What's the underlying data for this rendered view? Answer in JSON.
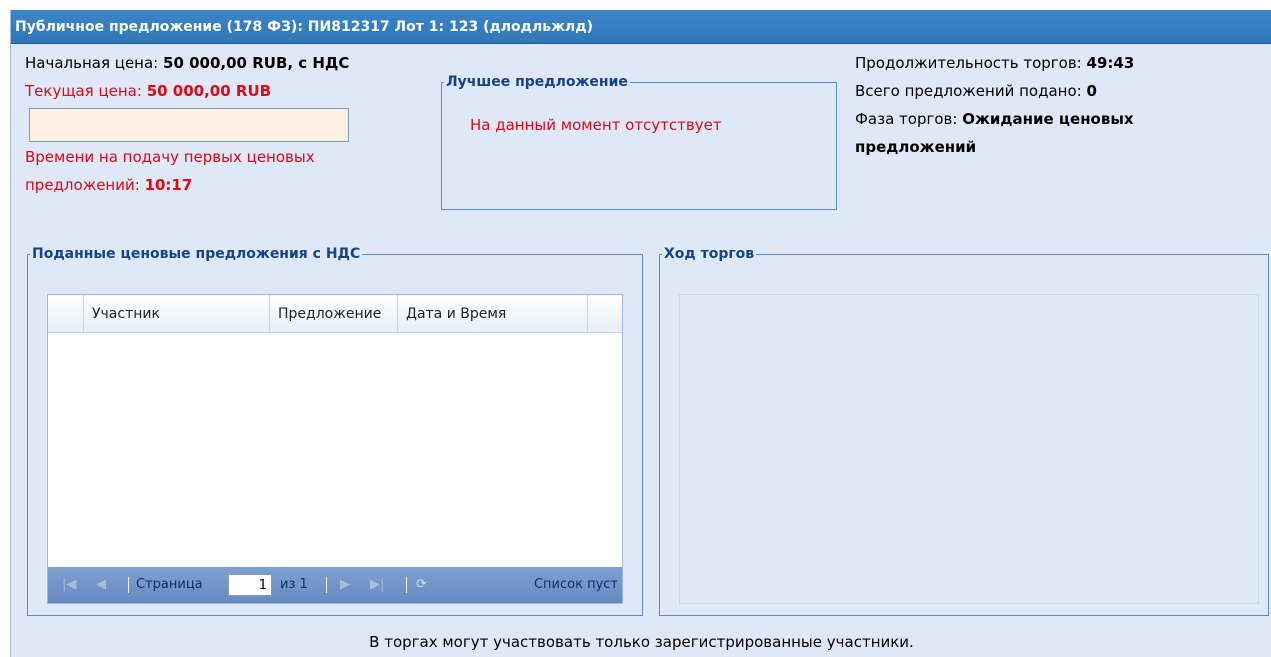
{
  "window": {
    "title": "Публичное предложение (178 ФЗ): ПИ812317 Лот 1: 123 (длодльжлд)"
  },
  "price": {
    "start_label": "Начальная цена: ",
    "start_value": "50 000,00 RUB, с НДС",
    "current_label": "Текущая цена: ",
    "current_value": "50 000,00 RUB",
    "time_label_line1": "Времени на подачу первых ценовых",
    "time_label_line2": "предложений: ",
    "time_value": "10:17",
    "input_value": ""
  },
  "best_offer": {
    "legend": "Лучшее предложение",
    "text": "На данный момент отсутствует"
  },
  "info": {
    "duration_label": "Продолжительность торгов: ",
    "duration_value": "49:43",
    "total_label": "Всего предложений подано: ",
    "total_value": "0",
    "phase_label": "Фаза торгов: ",
    "phase_value_line1": "Ожидание ценовых",
    "phase_value_line2": "предложений"
  },
  "offers": {
    "legend": "Поданные ценовые предложения с НДС",
    "columns": [
      "Участник",
      "Предложение",
      "Дата и Время"
    ],
    "rows": [],
    "pager": {
      "page_label": "Страница",
      "page_value": "1",
      "of_label": "из 1",
      "empty_text": "Список пуст"
    }
  },
  "history": {
    "legend": "Ход торгов"
  },
  "footer": {
    "note": "В торгах могут участвовать только зарегистрированные участники."
  },
  "colors": {
    "title_bar": "#2e76b8",
    "panel_bg": "#dfe8f6",
    "accent_red": "#e30613",
    "border": "#5b8ac7"
  }
}
